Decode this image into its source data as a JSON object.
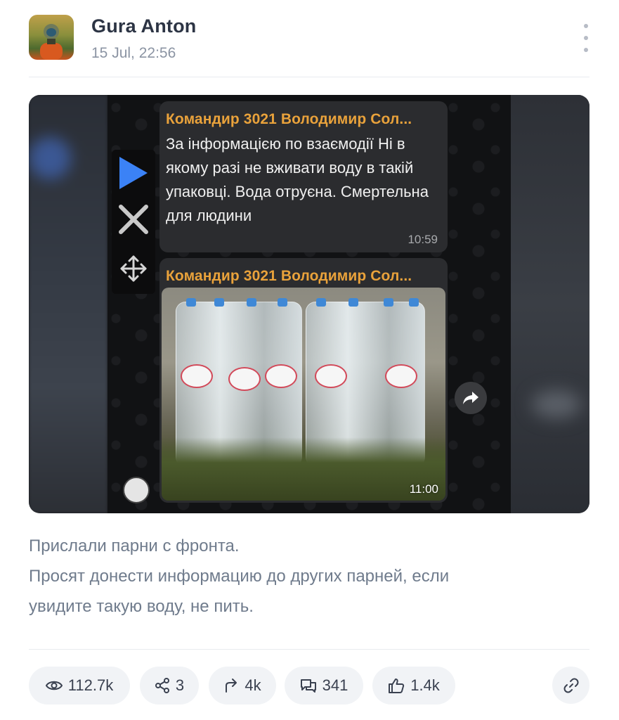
{
  "post": {
    "author": "Gura Anton",
    "date": "15 Jul, 22:56",
    "caption_lines": [
      "Прислали парни с фронта.",
      "Просят донести информацию до других парней, если",
      "увидите такую воду, не пить."
    ]
  },
  "media": {
    "message1": {
      "sender": "Командир 3021 Володимир Сол...",
      "text": "За інформацією по взаємодії Ні в якому разі не вживати воду в такій упаковці.  Вода отруєна. Смертельна для людини",
      "time": "10:59"
    },
    "message2": {
      "sender": "Командир 3021 Володимир Сол...",
      "time": "11:00",
      "photo_labels": [
        "saint spring",
        "святой источник",
        "saint spring",
        "saint spring"
      ]
    }
  },
  "stats": {
    "views": "112.7k",
    "shares": "3",
    "forwards": "4k",
    "comments": "341",
    "likes": "1.4k"
  },
  "icons": {
    "views": "eye-icon",
    "shares": "share-icon",
    "forwards": "forward-icon",
    "comments": "comments-icon",
    "likes": "thumbs-up-icon",
    "link": "link-icon",
    "more": "more-vertical-icon"
  },
  "colors": {
    "sender": "#e9a23b",
    "play_icon": "#3b82f6",
    "pill_background": "#f1f3f6",
    "caption": "#6f7b8c"
  }
}
